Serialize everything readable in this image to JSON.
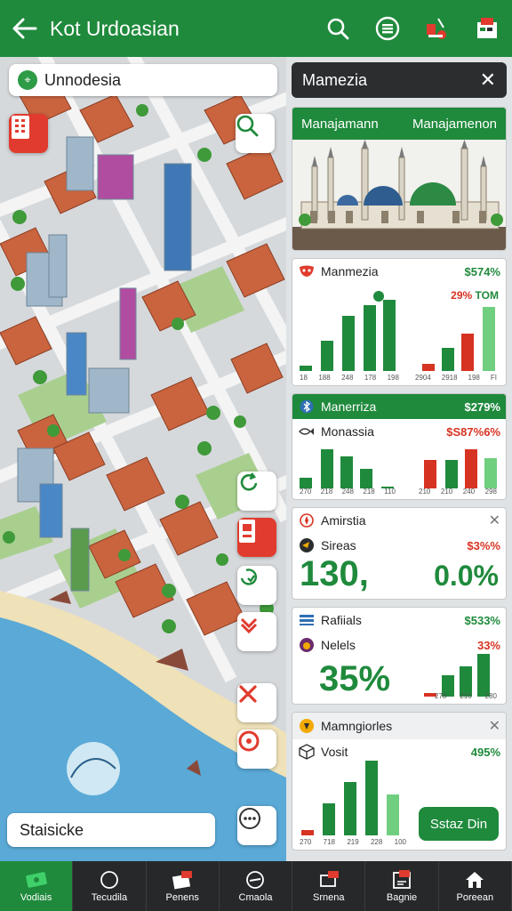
{
  "header": {
    "title": "Kot Urdoasian"
  },
  "map": {
    "search_label": "Unnodesia",
    "status_label": "Staisicke"
  },
  "panel": {
    "title": "Mamezia",
    "banner": {
      "left_label": "Manajamann",
      "right_label": "Manajamenon"
    },
    "card1": {
      "label": "Manmezia",
      "value": "$574%",
      "sub_left": "",
      "sub_red": "29%",
      "sub_green": "TOM",
      "ticks_left": [
        "18",
        "188",
        "248",
        "178",
        "198"
      ],
      "ticks_right": [
        "2904",
        "2918",
        "198",
        "FI"
      ]
    },
    "card2": {
      "header_label": "Manerriza",
      "header_value": "$279%",
      "label": "Monassia",
      "value": "$S87",
      "value2": "%6%",
      "ticks_left": [
        "270",
        "218",
        "248",
        "218",
        "110"
      ],
      "ticks_right": [
        "210",
        "210",
        "240",
        "298"
      ]
    },
    "card3": {
      "label": "Amirstia",
      "sub_label": "Sireas",
      "sub_value": "$3",
      "sub_value2": "%%",
      "big_left": "130,",
      "big_right": "0.0%"
    },
    "card4": {
      "label": "Rafiials",
      "value": "$533%",
      "sub_label": "Nelels",
      "sub_value": "33%",
      "big": "35%",
      "ticks": [
        "278",
        "210",
        "280"
      ]
    },
    "card5": {
      "label": "Mamngiorles",
      "sub_label": "Vosit",
      "sub_value": "495%",
      "ticks": [
        "270",
        "718",
        "219",
        "228",
        "100"
      ],
      "button": "Sstaz Din"
    }
  },
  "nav": {
    "items": [
      {
        "label": "Vodiais"
      },
      {
        "label": "Tecudila"
      },
      {
        "label": "Penens"
      },
      {
        "label": "Cmaola"
      },
      {
        "label": "Srnena"
      },
      {
        "label": "Bagnie"
      },
      {
        "label": "Poreean"
      }
    ]
  },
  "colors": {
    "brand_green": "#1f8a3c",
    "accent_red": "#d73322",
    "dark": "#262829"
  }
}
